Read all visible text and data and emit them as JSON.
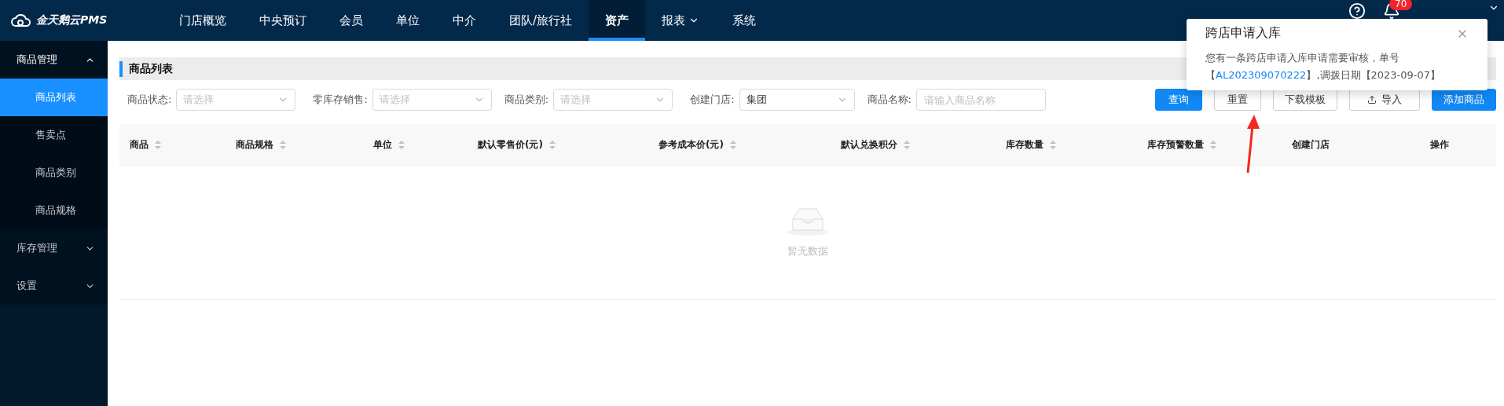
{
  "app": {
    "logo": "金天鹅云PMS"
  },
  "nav": [
    {
      "label": "门店概览",
      "selected": false,
      "dropdown": false
    },
    {
      "label": "中央预订",
      "selected": false,
      "dropdown": false
    },
    {
      "label": "会员",
      "selected": false,
      "dropdown": false
    },
    {
      "label": "单位",
      "selected": false,
      "dropdown": false
    },
    {
      "label": "中介",
      "selected": false,
      "dropdown": false
    },
    {
      "label": "团队/旅行社",
      "selected": false,
      "dropdown": false
    },
    {
      "label": "资产",
      "selected": true,
      "dropdown": false
    },
    {
      "label": "报表",
      "selected": false,
      "dropdown": true
    },
    {
      "label": "系统",
      "selected": false,
      "dropdown": false
    }
  ],
  "header": {
    "badge": "70"
  },
  "sidebar": [
    {
      "label": "商品管理",
      "expanded": true,
      "children": [
        {
          "label": "商品列表",
          "selected": true
        },
        {
          "label": "售卖点",
          "selected": false
        },
        {
          "label": "商品类别",
          "selected": false
        },
        {
          "label": "商品规格",
          "selected": false
        }
      ]
    },
    {
      "label": "库存管理",
      "expanded": false
    },
    {
      "label": "设置",
      "expanded": false
    }
  ],
  "page_title": "商品列表",
  "filters": [
    {
      "kind": "select",
      "label": "商品状态:",
      "placeholder": "请选择"
    },
    {
      "kind": "select",
      "label": "零库存销售:",
      "placeholder": "请选择"
    },
    {
      "kind": "select",
      "label": "商品类别:",
      "placeholder": "请选择"
    },
    {
      "kind": "select",
      "label": "创建门店:",
      "value": "集团"
    },
    {
      "kind": "input",
      "label": "商品名称:",
      "placeholder": "请输入商品名称"
    }
  ],
  "buttons": [
    {
      "label": "查询",
      "kind": "primary"
    },
    {
      "label": "重置",
      "kind": "default"
    },
    {
      "label": "下载模板",
      "kind": "default"
    },
    {
      "label": "导入",
      "kind": "upload"
    },
    {
      "label": "添加商品",
      "kind": "primary"
    }
  ],
  "table": {
    "columns": [
      {
        "label": "商品",
        "sortable": true
      },
      {
        "label": "商品规格",
        "sortable": true
      },
      {
        "label": "单位",
        "sortable": true
      },
      {
        "label": "默认零售价(元)",
        "sortable": true
      },
      {
        "label": "参考成本价(元)",
        "sortable": true
      },
      {
        "label": "默认兑换积分",
        "sortable": true
      },
      {
        "label": "库存数量",
        "sortable": true
      },
      {
        "label": "库存预警数量",
        "sortable": true
      },
      {
        "label": "创建门店",
        "sortable": false
      },
      {
        "label": "操作",
        "sortable": false
      }
    ],
    "empty_text": "暂无数据"
  },
  "notification": {
    "title": "跨店申请入库",
    "line1": "您有一条跨店申请入库申请需要审核，单号",
    "open": "【",
    "link": "AL202309070222",
    "close": "】,调拨日期【2023-09-07】"
  }
}
